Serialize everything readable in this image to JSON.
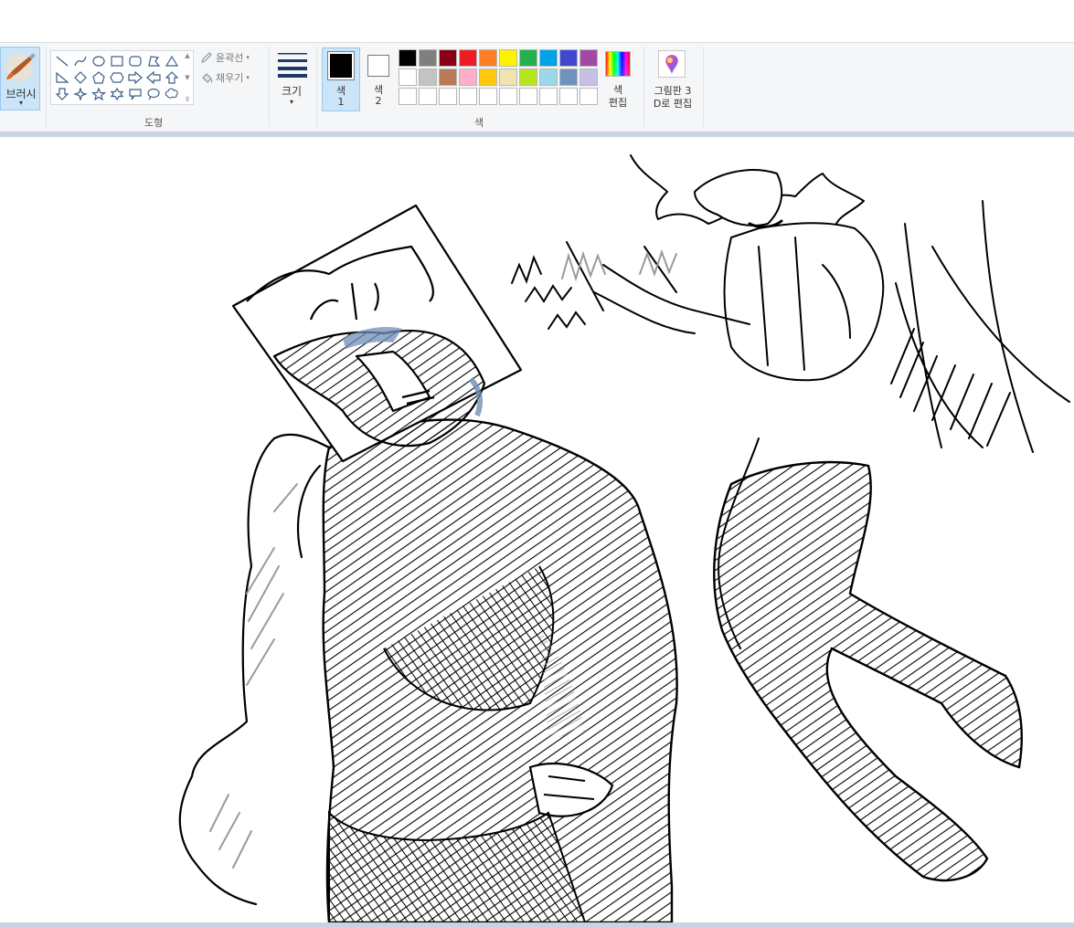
{
  "ribbon": {
    "brush": {
      "label": "브러시",
      "arrow": "▾",
      "icon": "brush-icon"
    },
    "shapes": {
      "group_label": "도형",
      "items": [
        "line",
        "curve",
        "oval",
        "rectangle",
        "rounded-rectangle",
        "polygon",
        "triangle",
        "right-triangle",
        "diamond",
        "pentagon",
        "hexagon",
        "right-arrow",
        "left-arrow",
        "up-arrow",
        "down-arrow",
        "four-point-star",
        "five-point-star",
        "six-point-star",
        "rounded-callout",
        "oval-callout",
        "cloud-callout"
      ],
      "outline_label": "윤곽선",
      "fill_label": "채우기"
    },
    "size": {
      "label": "크기",
      "arrow": "▾"
    },
    "colors": {
      "group_label": "색",
      "color1": {
        "label": "색",
        "num": "1",
        "value": "#000000"
      },
      "color2": {
        "label": "색",
        "num": "2",
        "value": "#ffffff"
      },
      "palette": [
        "#000000",
        "#7f7f7f",
        "#880015",
        "#ed1c24",
        "#ff7f27",
        "#fff200",
        "#22b14c",
        "#00a2e8",
        "#3f48cc",
        "#a349a4",
        "#ffffff",
        "#c3c3c3",
        "#b97a57",
        "#ffaec9",
        "#ffc90e",
        "#efe4b0",
        "#b5e61d",
        "#99d9ea",
        "#7092be",
        "#c8bfe7",
        "#ffffff",
        "#ffffff",
        "#ffffff",
        "#ffffff",
        "#ffffff",
        "#ffffff",
        "#ffffff",
        "#ffffff",
        "#ffffff",
        "#ffffff"
      ],
      "edit_label_line1": "색",
      "edit_label_line2": "편집"
    },
    "paint3d": {
      "line1": "그림판 3",
      "line2": "D로 편집",
      "icon": "paint3d-icon"
    }
  },
  "canvas": {
    "description_icon": "sketch-drawing",
    "accent_color": "#6f8fb5"
  }
}
